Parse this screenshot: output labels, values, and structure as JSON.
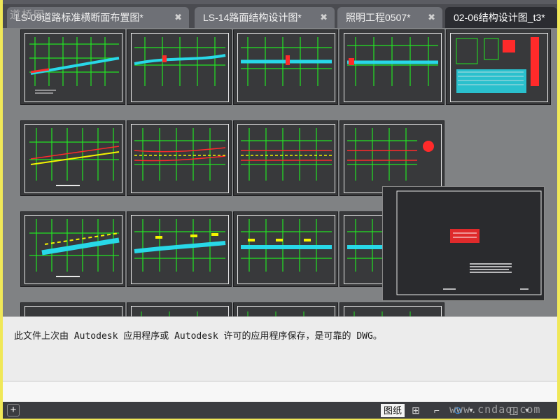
{
  "watermark_top": "道桥网",
  "tabs": [
    {
      "label": "LS-09道路标准横断面布置图*",
      "close": "✖",
      "active": false
    },
    {
      "label": "LS-14路面结构设计图*",
      "close": "✖",
      "active": false
    },
    {
      "label": "照明工程0507*",
      "close": "✖",
      "active": false
    },
    {
      "label": "02-06结构设计图_t3*",
      "close": "",
      "active": true
    }
  ],
  "message": "此文件上次由 Autodesk 应用程序或 Autodesk 许可的应用程序保存，是可靠的 DWG。",
  "statusbar": {
    "add_label": "+",
    "paper_label": "图纸",
    "watermark_bottom": "www.cndao.com"
  },
  "colors": {
    "app_background": "#5b5c62",
    "canvas": "#808284",
    "sheet": "#38393b",
    "drawing_green": "#22e522",
    "drawing_cyan": "#28d8e8",
    "drawing_red": "#ff2a2a",
    "drawing_yellow": "#f4f400",
    "outer_border": "#f0e858"
  }
}
